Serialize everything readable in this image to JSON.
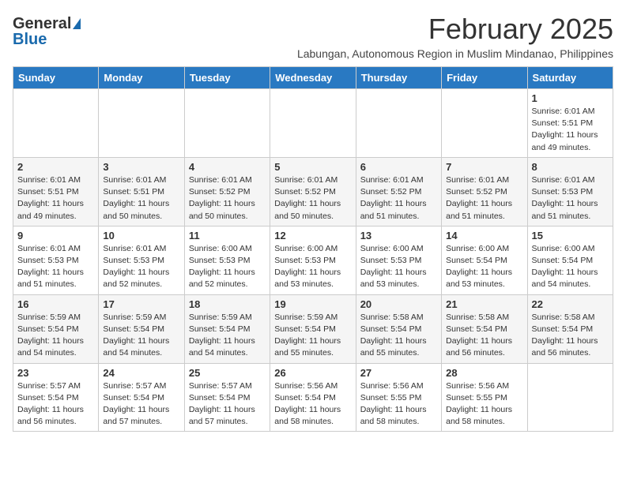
{
  "logo": {
    "general": "General",
    "blue": "Blue"
  },
  "title": {
    "month_year": "February 2025",
    "location": "Labungan, Autonomous Region in Muslim Mindanao, Philippines"
  },
  "days_of_week": [
    "Sunday",
    "Monday",
    "Tuesday",
    "Wednesday",
    "Thursday",
    "Friday",
    "Saturday"
  ],
  "weeks": [
    [
      {
        "day": "",
        "info": ""
      },
      {
        "day": "",
        "info": ""
      },
      {
        "day": "",
        "info": ""
      },
      {
        "day": "",
        "info": ""
      },
      {
        "day": "",
        "info": ""
      },
      {
        "day": "",
        "info": ""
      },
      {
        "day": "1",
        "info": "Sunrise: 6:01 AM\nSunset: 5:51 PM\nDaylight: 11 hours\nand 49 minutes."
      }
    ],
    [
      {
        "day": "2",
        "info": "Sunrise: 6:01 AM\nSunset: 5:51 PM\nDaylight: 11 hours\nand 49 minutes."
      },
      {
        "day": "3",
        "info": "Sunrise: 6:01 AM\nSunset: 5:51 PM\nDaylight: 11 hours\nand 50 minutes."
      },
      {
        "day": "4",
        "info": "Sunrise: 6:01 AM\nSunset: 5:52 PM\nDaylight: 11 hours\nand 50 minutes."
      },
      {
        "day": "5",
        "info": "Sunrise: 6:01 AM\nSunset: 5:52 PM\nDaylight: 11 hours\nand 50 minutes."
      },
      {
        "day": "6",
        "info": "Sunrise: 6:01 AM\nSunset: 5:52 PM\nDaylight: 11 hours\nand 51 minutes."
      },
      {
        "day": "7",
        "info": "Sunrise: 6:01 AM\nSunset: 5:52 PM\nDaylight: 11 hours\nand 51 minutes."
      },
      {
        "day": "8",
        "info": "Sunrise: 6:01 AM\nSunset: 5:53 PM\nDaylight: 11 hours\nand 51 minutes."
      }
    ],
    [
      {
        "day": "9",
        "info": "Sunrise: 6:01 AM\nSunset: 5:53 PM\nDaylight: 11 hours\nand 51 minutes."
      },
      {
        "day": "10",
        "info": "Sunrise: 6:01 AM\nSunset: 5:53 PM\nDaylight: 11 hours\nand 52 minutes."
      },
      {
        "day": "11",
        "info": "Sunrise: 6:00 AM\nSunset: 5:53 PM\nDaylight: 11 hours\nand 52 minutes."
      },
      {
        "day": "12",
        "info": "Sunrise: 6:00 AM\nSunset: 5:53 PM\nDaylight: 11 hours\nand 53 minutes."
      },
      {
        "day": "13",
        "info": "Sunrise: 6:00 AM\nSunset: 5:53 PM\nDaylight: 11 hours\nand 53 minutes."
      },
      {
        "day": "14",
        "info": "Sunrise: 6:00 AM\nSunset: 5:54 PM\nDaylight: 11 hours\nand 53 minutes."
      },
      {
        "day": "15",
        "info": "Sunrise: 6:00 AM\nSunset: 5:54 PM\nDaylight: 11 hours\nand 54 minutes."
      }
    ],
    [
      {
        "day": "16",
        "info": "Sunrise: 5:59 AM\nSunset: 5:54 PM\nDaylight: 11 hours\nand 54 minutes."
      },
      {
        "day": "17",
        "info": "Sunrise: 5:59 AM\nSunset: 5:54 PM\nDaylight: 11 hours\nand 54 minutes."
      },
      {
        "day": "18",
        "info": "Sunrise: 5:59 AM\nSunset: 5:54 PM\nDaylight: 11 hours\nand 54 minutes."
      },
      {
        "day": "19",
        "info": "Sunrise: 5:59 AM\nSunset: 5:54 PM\nDaylight: 11 hours\nand 55 minutes."
      },
      {
        "day": "20",
        "info": "Sunrise: 5:58 AM\nSunset: 5:54 PM\nDaylight: 11 hours\nand 55 minutes."
      },
      {
        "day": "21",
        "info": "Sunrise: 5:58 AM\nSunset: 5:54 PM\nDaylight: 11 hours\nand 56 minutes."
      },
      {
        "day": "22",
        "info": "Sunrise: 5:58 AM\nSunset: 5:54 PM\nDaylight: 11 hours\nand 56 minutes."
      }
    ],
    [
      {
        "day": "23",
        "info": "Sunrise: 5:57 AM\nSunset: 5:54 PM\nDaylight: 11 hours\nand 56 minutes."
      },
      {
        "day": "24",
        "info": "Sunrise: 5:57 AM\nSunset: 5:54 PM\nDaylight: 11 hours\nand 57 minutes."
      },
      {
        "day": "25",
        "info": "Sunrise: 5:57 AM\nSunset: 5:54 PM\nDaylight: 11 hours\nand 57 minutes."
      },
      {
        "day": "26",
        "info": "Sunrise: 5:56 AM\nSunset: 5:54 PM\nDaylight: 11 hours\nand 58 minutes."
      },
      {
        "day": "27",
        "info": "Sunrise: 5:56 AM\nSunset: 5:55 PM\nDaylight: 11 hours\nand 58 minutes."
      },
      {
        "day": "28",
        "info": "Sunrise: 5:56 AM\nSunset: 5:55 PM\nDaylight: 11 hours\nand 58 minutes."
      },
      {
        "day": "",
        "info": ""
      }
    ]
  ]
}
